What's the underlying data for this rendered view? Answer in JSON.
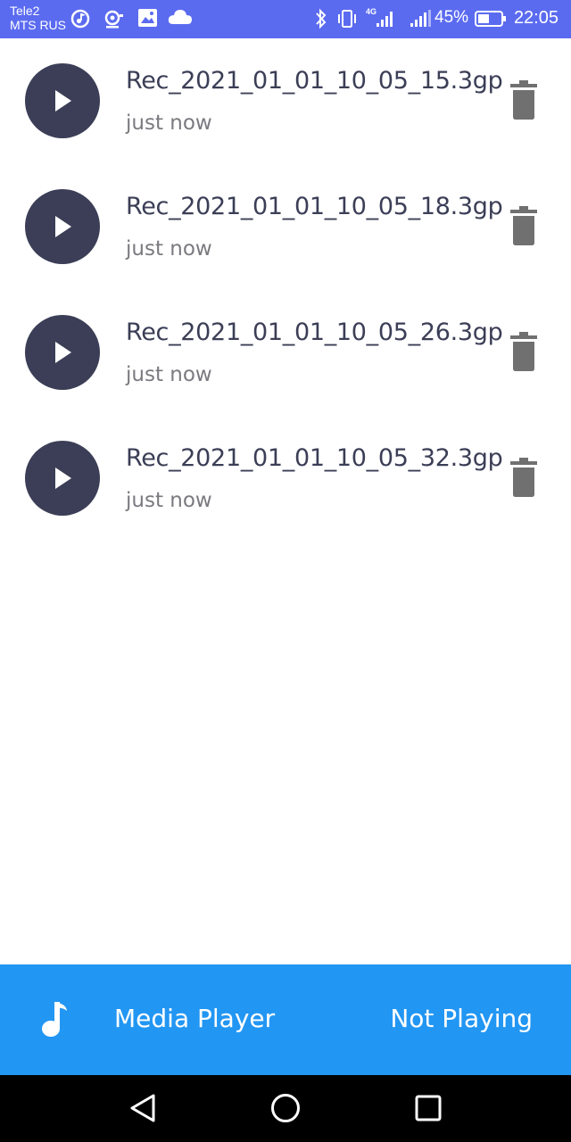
{
  "status_bar": {
    "carrier_1": "Tele2",
    "carrier_2": "MTS RUS",
    "network_badge": "4G",
    "battery": "45%",
    "time": "22:05"
  },
  "recordings": [
    {
      "name": "Rec_2021_01_01_10_05_15.3gp",
      "time": "just now"
    },
    {
      "name": "Rec_2021_01_01_10_05_18.3gp",
      "time": "just now"
    },
    {
      "name": "Rec_2021_01_01_10_05_26.3gp",
      "time": "just now"
    },
    {
      "name": "Rec_2021_01_01_10_05_32.3gp",
      "time": "just now"
    }
  ],
  "player": {
    "icon": "music-note-icon",
    "title": "Media Player",
    "status": "Not Playing"
  },
  "navigation": {
    "back_icon": "back-icon",
    "home_icon": "home-icon",
    "recents_icon": "recents-icon"
  },
  "colors": {
    "status_bar": "#5b6bf0",
    "play_button": "#3b3e56",
    "delete_icon": "#707070",
    "player_bar": "#2296f3",
    "nav_bar": "#000000"
  }
}
